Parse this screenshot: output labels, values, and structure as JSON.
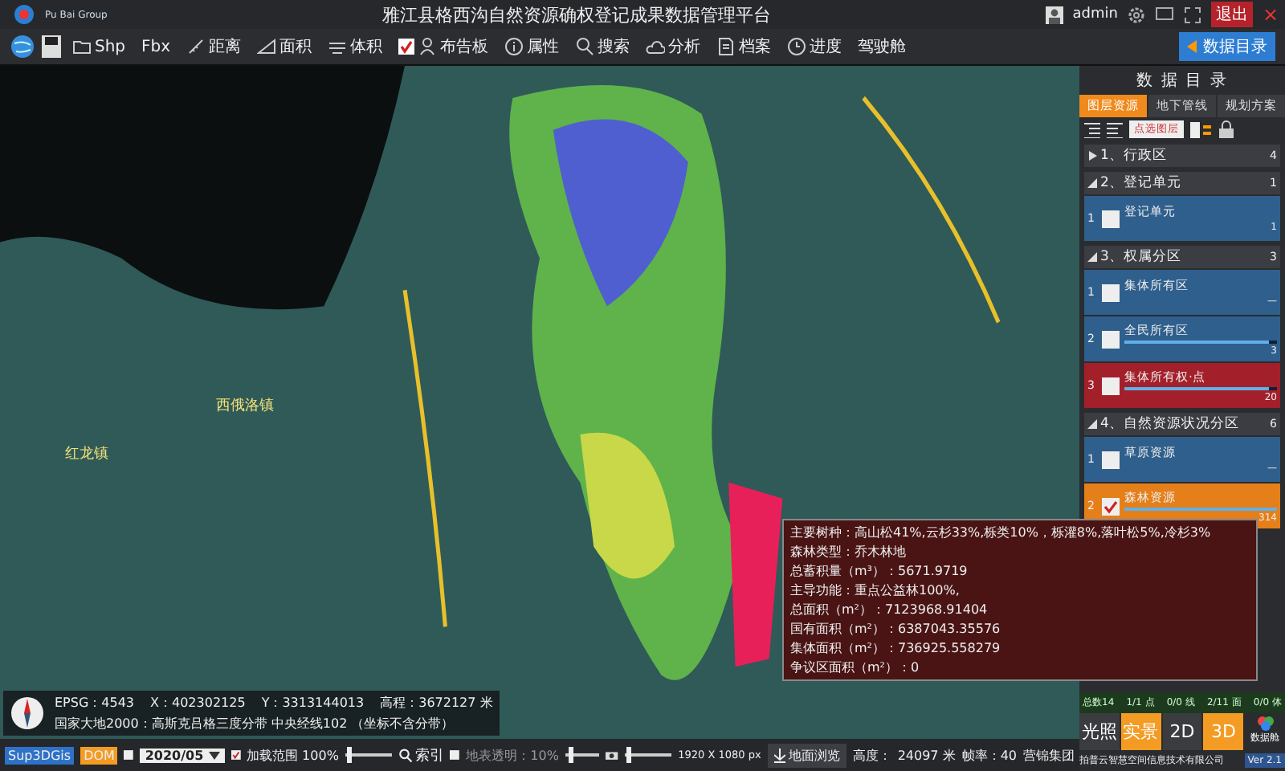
{
  "header": {
    "logo_text": "Pu Bai Group",
    "title": "雅江县格西沟自然资源确权登记成果数据管理平台",
    "user": "admin",
    "logout": "退出",
    "close": "×"
  },
  "toolbar": {
    "items": [
      {
        "kind": "icon"
      },
      {
        "kind": "icon"
      },
      {
        "kind": "tool",
        "label": "Shp"
      },
      {
        "kind": "plain",
        "label": "Fbx"
      },
      {
        "kind": "tool",
        "label": "距离"
      },
      {
        "kind": "tool",
        "label": "面积"
      },
      {
        "kind": "tool",
        "label": "体积"
      },
      {
        "kind": "check",
        "checked": true,
        "label": "布告板"
      },
      {
        "kind": "tool",
        "label": "属性"
      },
      {
        "kind": "tool",
        "label": "搜索"
      },
      {
        "kind": "tool",
        "label": "分析"
      },
      {
        "kind": "tool",
        "label": "档案"
      },
      {
        "kind": "tool",
        "label": "进度"
      },
      {
        "kind": "plain",
        "label": "驾驶舱"
      }
    ],
    "catalog_button": "数据目录"
  },
  "map": {
    "places": [
      "西俄洛镇",
      "红龙镇"
    ],
    "coordinates": {
      "epsg": "EPSG：4543",
      "x": "X：402302125",
      "y": "Y：3313144013",
      "elevation": "高程：3672127 米",
      "projection": "国家大地2000：高斯克吕格三度分带 中央经线102 （坐标不含分带）"
    }
  },
  "popup": {
    "lines": [
      "主要树种：高山松41%,云杉33%,栎类10%，栎灌8%,落叶松5%,冷杉3%",
      "森林类型：乔木林地",
      "总蓄积量（m³）：5671.9719",
      "主导功能：重点公益林100%,",
      "总面积（m²）：7123968.91404",
      "国有面积（m²）：6387043.35576",
      "集体面积（m²）：736925.558279",
      "争议区面积（m²）：0"
    ]
  },
  "panel": {
    "title": "数 据 目 录",
    "tabs": [
      {
        "label": "图层资源",
        "selected": true
      },
      {
        "label": "地下管线",
        "selected": false
      },
      {
        "label": "规划方案",
        "selected": false
      }
    ],
    "pick_button": "点选图层",
    "groups": [
      {
        "title": "1、行政区",
        "count": "4",
        "expanded": false
      },
      {
        "title": "2、登记单元",
        "count": "1",
        "expanded": true,
        "children": [
          {
            "index": "1",
            "name": "登记单元",
            "count": "1",
            "checked": false,
            "selected": false
          }
        ]
      },
      {
        "title": "3、权属分区",
        "count": "3",
        "expanded": true,
        "children": [
          {
            "index": "1",
            "name": "集体所有区",
            "count": "—",
            "checked": false,
            "selected": false
          },
          {
            "index": "2",
            "name": "全民所有区",
            "count": "3",
            "checked": false,
            "selected": false,
            "level": 0.95
          },
          {
            "index": "3",
            "name": "集体所有权·点",
            "count": "20",
            "checked": false,
            "selected": true,
            "level": 0.95
          }
        ]
      },
      {
        "title": "4、自然资源状况分区",
        "count": "6",
        "expanded": true,
        "children": [
          {
            "index": "1",
            "name": "草原资源",
            "count": "—",
            "checked": false,
            "selected": false
          },
          {
            "index": "2",
            "name": "森林资源",
            "count": "314",
            "checked": true,
            "selected": false,
            "level": 1
          }
        ]
      }
    ],
    "stats": [
      "总数14",
      "1/1 点",
      "0/0 线",
      "2/11 面",
      "0/0 体"
    ],
    "modes": [
      {
        "label": "光照",
        "selected": false
      },
      {
        "label": "实景",
        "selected": true
      },
      {
        "label": "2D",
        "selected": false
      },
      {
        "label": "3D",
        "selected": true
      }
    ],
    "cockpit": "数据舱",
    "footer": "拍普云智慧空间信息技术有限公司",
    "version": "Ver 2.1"
  },
  "status_bar": {
    "brand": "Sup3DGis",
    "layer": "DOM",
    "date": {
      "checked": false,
      "label": "2020/05"
    },
    "load": {
      "checked": true,
      "label": "加载范围 100%",
      "level": 0.05
    },
    "index_button": "索引",
    "transparency": {
      "checked": false,
      "label": "地表透明：10%",
      "level": 0.1
    },
    "resolution": {
      "level": 0.05,
      "label": "1920 X 1080 px"
    },
    "browse": "地面浏览",
    "height_label": "高度：",
    "height": "24097 米",
    "fps": "帧率：40",
    "company": "营锦集团"
  }
}
